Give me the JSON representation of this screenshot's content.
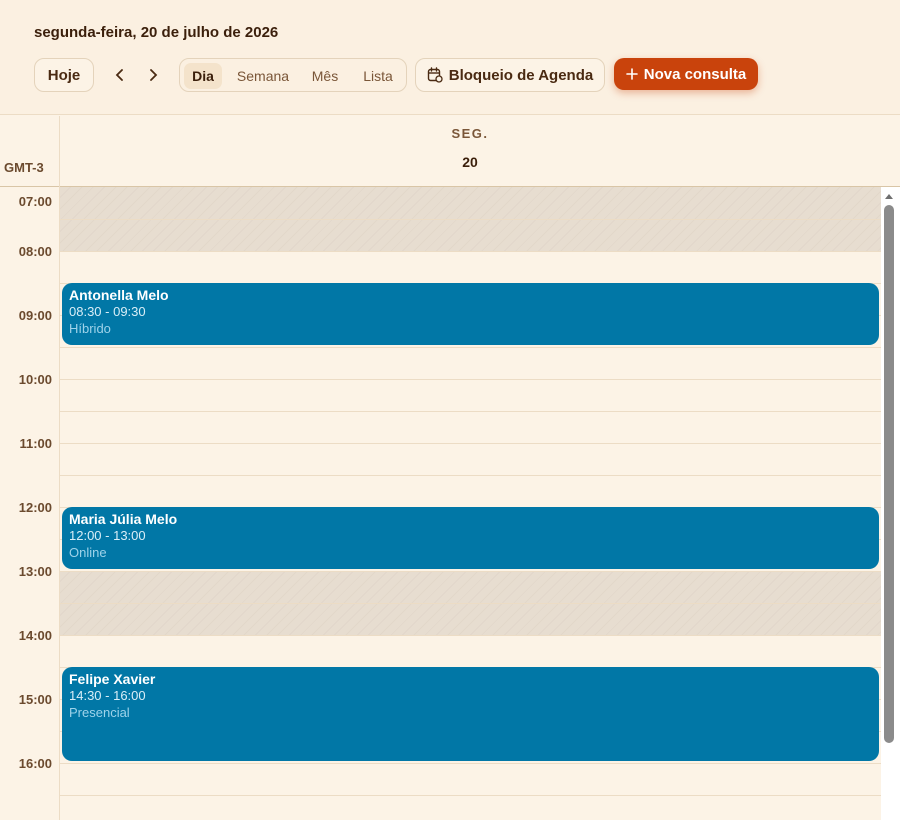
{
  "header": {
    "date_title": "segunda-feira, 20 de julho de 2026",
    "today_label": "Hoje",
    "views": [
      "Dia",
      "Semana",
      "Mês",
      "Lista"
    ],
    "active_view": "Dia",
    "block_label": "Bloqueio de Agenda",
    "new_label": "Nova consulta"
  },
  "day": {
    "timezone": "GMT-3",
    "weekday": "SEG.",
    "number": "20"
  },
  "hours": [
    "07:00",
    "08:00",
    "09:00",
    "10:00",
    "11:00",
    "12:00",
    "13:00",
    "14:00",
    "15:00",
    "16:00"
  ],
  "events": [
    {
      "name": "Antonella Melo",
      "time": "08:30 - 09:30",
      "mode": "Híbrido"
    },
    {
      "name": "Maria Júlia Melo",
      "time": "12:00 - 13:00",
      "mode": "Online"
    },
    {
      "name": "Felipe Xavier",
      "time": "14:30 - 16:00",
      "mode": "Presencial"
    }
  ],
  "colors": {
    "accent": "#c9430c",
    "event": "#0177a6",
    "background": "#fcf3e6"
  }
}
